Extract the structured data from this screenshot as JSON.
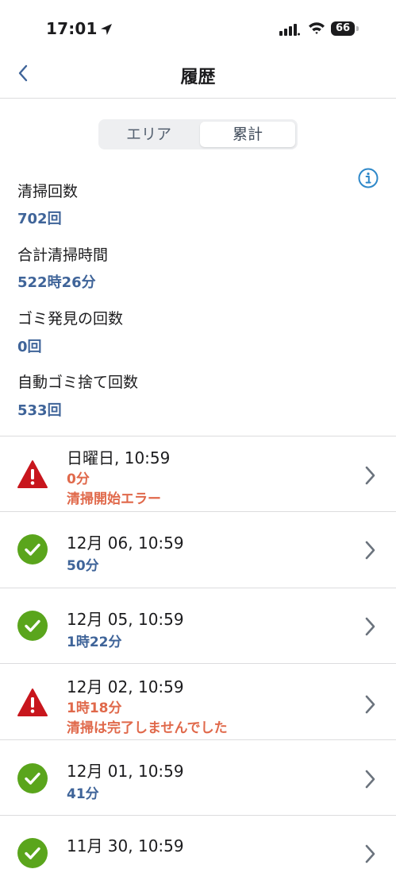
{
  "status_bar": {
    "time": "17:01",
    "battery": "66"
  },
  "nav": {
    "title": "履歴"
  },
  "segmented": {
    "tabs": [
      "エリア",
      "累計"
    ],
    "selected": "累計"
  },
  "stats": [
    {
      "label": "清掃回数",
      "value": "702回"
    },
    {
      "label": "合計清掃時間",
      "value": "522時26分"
    },
    {
      "label": "ゴミ発見の回数",
      "value": "0回"
    },
    {
      "label": "自動ゴミ捨て回数",
      "value": "533回"
    }
  ],
  "history": [
    {
      "date": "日曜日, 10:59",
      "duration": "0分",
      "status_text": "清掃開始エラー",
      "state": "error"
    },
    {
      "date": "12月 06, 10:59",
      "duration": "50分",
      "status_text": "",
      "state": "success"
    },
    {
      "date": "12月 05, 10:59",
      "duration": "1時22分",
      "status_text": "",
      "state": "success"
    },
    {
      "date": "12月 02, 10:59",
      "duration": "1時18分",
      "status_text": "清掃は完了しませんでした",
      "state": "error"
    },
    {
      "date": "12月 01, 10:59",
      "duration": "41分",
      "status_text": "",
      "state": "success"
    },
    {
      "date": "11月 30, 10:59",
      "duration": "",
      "status_text": "",
      "state": "success"
    }
  ],
  "colors": {
    "accent_blue": "#3f6499",
    "error_red": "#c8161d",
    "error_text": "#e0694b",
    "success_green": "#5aa51c",
    "info_blue": "#2e88c9"
  },
  "icons": {
    "back": "chevron-left-icon",
    "info": "info-circle-icon",
    "error": "warning-triangle-icon",
    "success": "checkmark-circle-icon",
    "row": "chevron-right-icon"
  }
}
